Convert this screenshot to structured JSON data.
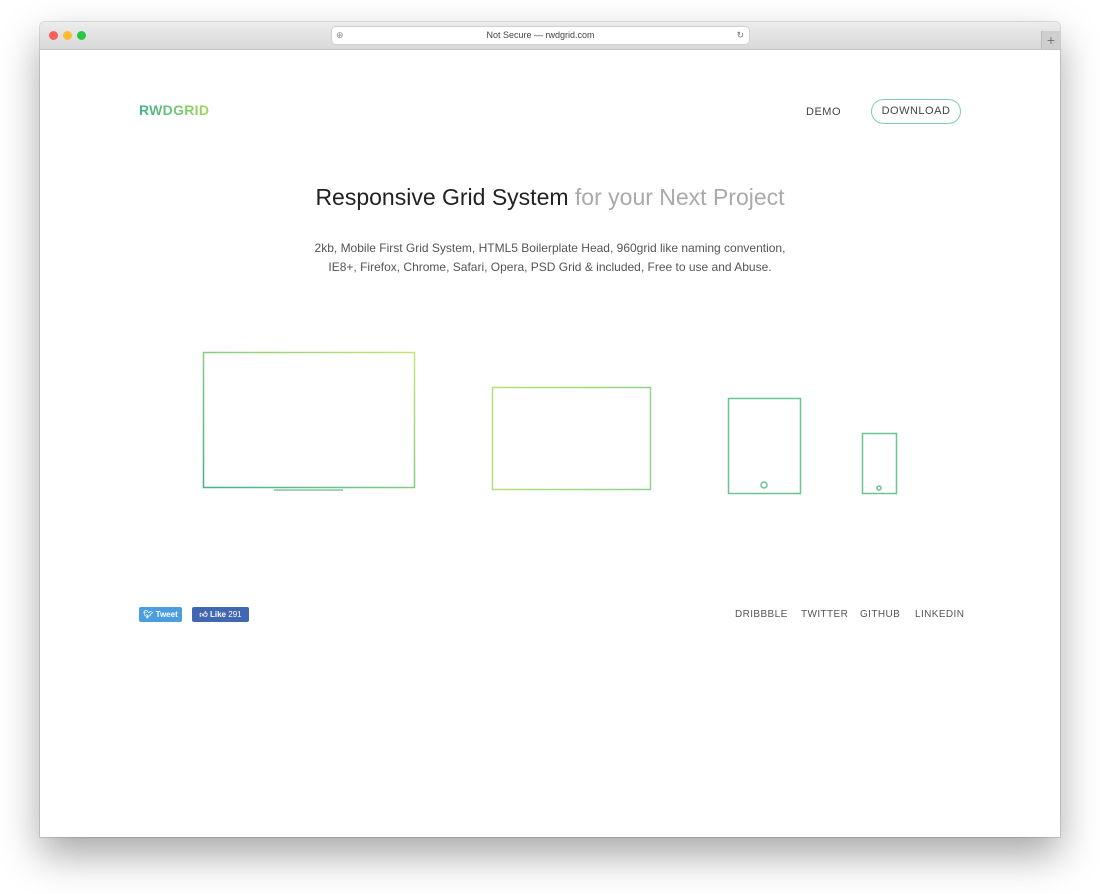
{
  "browser": {
    "url_text": "Not Secure — rwdgrid.com",
    "new_tab": "+"
  },
  "header": {
    "logo": "RWDGRID",
    "nav_demo": "DEMO",
    "nav_download": "DOWNLOAD"
  },
  "hero": {
    "title_strong": "Responsive Grid System",
    "title_light": "for your Next Project",
    "desc_line1": "2kb, Mobile First Grid System, HTML5 Boilerplate Head, 960grid like naming convention,",
    "desc_line2": "IE8+, Firefox, Chrome, Safari, Opera, PSD Grid & included, Free to use and Abuse."
  },
  "colors": {
    "gradient_start": "#45b08c",
    "gradient_end": "#c8e67a"
  },
  "footer": {
    "tweet": "Tweet",
    "like": "Like",
    "like_count": "291",
    "links": [
      "DRIBBBLE",
      "TWITTER",
      "GITHUB",
      "LINKEDIN"
    ]
  }
}
